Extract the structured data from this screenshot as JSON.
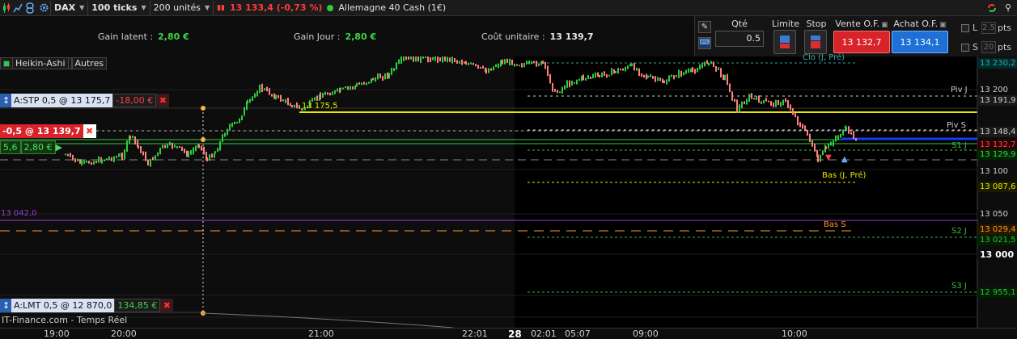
{
  "toolbar": {
    "symbol": "DAX",
    "interval": "100 ticks",
    "units": "200 unités",
    "last_price": "13 133,4 (-0,73 %)",
    "instrument": "Allemagne 40 Cash (1€)"
  },
  "summary": {
    "latent_label": "Gain latent :",
    "latent_value": "2,80 €",
    "day_label": "Gain Jour :",
    "day_value": "2,80 €",
    "unit_label": "Coût unitaire :",
    "unit_value": "13 139,7"
  },
  "order_panel": {
    "qty_label": "Qté",
    "qty_value": "0.5",
    "limit_label": "Limite",
    "stop_label": "Stop",
    "sell_label": "Vente O.F.",
    "sell_price": "13 132,7",
    "buy_label": "Achat O.F.",
    "buy_price": "13 134,1",
    "l_label": "L",
    "s_label": "S",
    "l_value": "2.5",
    "s_value": "20",
    "pts": "pts"
  },
  "chart": {
    "indicator": "Heikin-Ashi",
    "others": "Autres",
    "stp_label": "A:STP  0,5 @ 13 175,7",
    "stp_pnl": "-18,00 €",
    "pos_label": "-0,5 @ 13 139,7",
    "pos_qty": "5,6",
    "pos_pnl": "2,80 €",
    "lmt_label": "A:LMT  0,5 @ 12 870,0",
    "lmt_pnl": "134,85 €",
    "line_13042": "13 042,0",
    "line_13175": "13 175,5",
    "clo_j": "Clo (J, Pré)",
    "piv_j": "Piv J",
    "piv_s": "Piv S",
    "s1_j": "S1 J",
    "bas_j": "Bas (J, Pré)",
    "bas_s": "Bas S",
    "s2_j": "S2 J",
    "s3_j": "S3 J",
    "watermark": "IT-Finance.com - Temps Réel",
    "colors": {
      "up": "#2ecc40",
      "down": "#ff8080",
      "yellow": "#e6e600",
      "purple": "#9a3ad6",
      "orange": "#ff9a1a"
    }
  },
  "price_axis": [
    {
      "v": "13 230,2",
      "c": "#0d0d0d",
      "t": "#3aa9a9",
      "bg": "#002b2b"
    },
    {
      "v": "13 200",
      "c": "#0d0d0d",
      "t": "#cfcfcf",
      "bg": "#0d0d0d"
    },
    {
      "v": "13 191,9",
      "c": "#0d0d0d",
      "t": "#cfcfcf",
      "bg": "#1b1b1b"
    },
    {
      "v": "13 148,4",
      "c": "#0d0d0d",
      "t": "#cfcfcf",
      "bg": "#1b1b1b"
    },
    {
      "v": "13 132,7",
      "c": "#0d0d0d",
      "t": "#ff4b4b",
      "bg": "#2a0000"
    },
    {
      "v": "13 129,9",
      "c": "#0d0d0d",
      "t": "#3fd34a",
      "bg": "#002400"
    },
    {
      "v": "13 100",
      "c": "#0d0d0d",
      "t": "#cfcfcf",
      "bg": "#0d0d0d"
    },
    {
      "v": "13 087,6",
      "c": "#0d0d0d",
      "t": "#e6e600",
      "bg": "#1b1b00"
    },
    {
      "v": "13 050",
      "c": "#0d0d0d",
      "t": "#cfcfcf",
      "bg": "#0d0d0d"
    },
    {
      "v": "13 029,4",
      "c": "#0d0d0d",
      "t": "#ff9a1a",
      "bg": "#261600"
    },
    {
      "v": "13 021,5",
      "c": "#0d0d0d",
      "t": "#3fb54a",
      "bg": "#002000"
    },
    {
      "v": "13 000",
      "c": "#0d0d0d",
      "t": "#ffffff",
      "bg": "#0d0d0d"
    },
    {
      "v": "12 955,1",
      "c": "#0d0d0d",
      "t": "#3fb54a",
      "bg": "#002000"
    }
  ],
  "time_axis": [
    "19:00",
    "20:00",
    "21:00",
    "22:01",
    "28",
    "02:01",
    "05:07",
    "09:00",
    "10:00"
  ]
}
